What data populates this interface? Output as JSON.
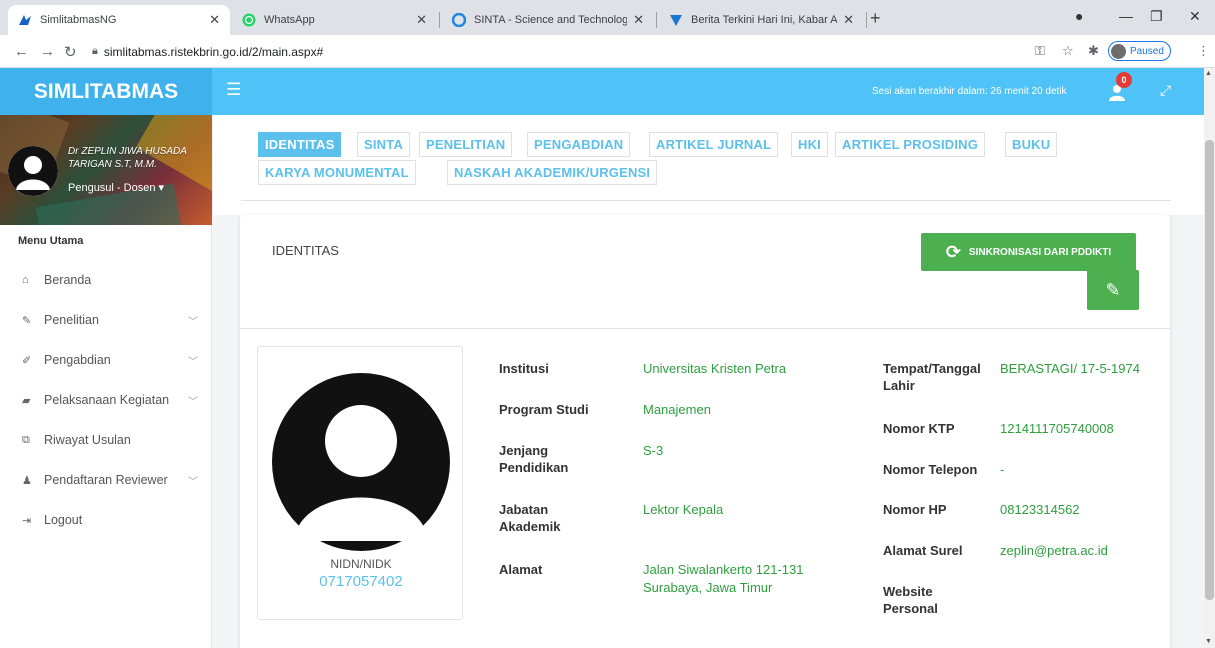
{
  "browser": {
    "tabs": [
      {
        "title": "SimlitabmasNG",
        "favicon": "simlitabmas-logo-icon"
      },
      {
        "title": "WhatsApp",
        "favicon": "whatsapp-icon"
      },
      {
        "title": "SINTA - Science and Technology I",
        "favicon": "sinta-icon"
      },
      {
        "title": "Berita Terkini Hari Ini, Kabar Akur",
        "favicon": "news-icon"
      }
    ],
    "url": "simlitabmas.ristekbrin.go.id/2/main.aspx#",
    "profile_status": "Paused"
  },
  "header": {
    "app_name": "SIMLITABMAS",
    "session_text": "Sesi akan berakhir dalam: 26 menit 20 detik",
    "notification_count": "0",
    "accent_color": "#4fc3f7"
  },
  "sidebar": {
    "user_name": "Dr ZEPLIN JIWA HUSADA TARIGAN S.T, M.M.",
    "user_role": "Pengusul - Dosen",
    "menu_heading": "Menu Utama",
    "items": [
      {
        "label": "Beranda",
        "icon": "home-icon",
        "has_children": false
      },
      {
        "label": "Penelitian",
        "icon": "edit-icon",
        "has_children": true
      },
      {
        "label": "Pengabdian",
        "icon": "pencil-icon",
        "has_children": true
      },
      {
        "label": "Pelaksanaan Kegiatan",
        "icon": "book-icon",
        "has_children": true
      },
      {
        "label": "Riwayat Usulan",
        "icon": "copy-icon",
        "has_children": false
      },
      {
        "label": "Pendaftaran Reviewer",
        "icon": "user-icon",
        "has_children": true
      },
      {
        "label": "Logout",
        "icon": "sign-out-icon",
        "has_children": false
      }
    ]
  },
  "profile_tabs": [
    {
      "label": "IDENTITAS",
      "active": true
    },
    {
      "label": "SINTA",
      "active": false
    },
    {
      "label": "PENELITIAN",
      "active": false
    },
    {
      "label": "PENGABDIAN",
      "active": false
    },
    {
      "label": "ARTIKEL JURNAL",
      "active": false
    },
    {
      "label": "HKI",
      "active": false
    },
    {
      "label": "ARTIKEL PROSIDING",
      "active": false
    },
    {
      "label": "BUKU",
      "active": false
    },
    {
      "label": "KARYA MONUMENTAL",
      "active": false
    },
    {
      "label": "NASKAH AKADEMIK/URGENSI",
      "active": false
    }
  ],
  "identity": {
    "title": "IDENTITAS",
    "sync_button": "SINKRONISASI DARI PDDIKTI",
    "nidn_label": "NIDN/NIDK",
    "nidn_value": "0717057402",
    "left_fields": [
      {
        "label": "Institusi",
        "value": "Universitas Kristen Petra"
      },
      {
        "label": "Program Studi",
        "value": "Manajemen"
      },
      {
        "label": "Jenjang Pendidikan",
        "value": "S-3"
      },
      {
        "label": "Jabatan Akademik",
        "value": "Lektor Kepala"
      },
      {
        "label": "Alamat",
        "value": "Jalan Siwalankerto 121-131 Surabaya, Jawa Timur"
      }
    ],
    "right_fields": [
      {
        "label": "Tempat/Tanggal Lahir",
        "value": "BERASTAGI/ 17-5-1974"
      },
      {
        "label": "Nomor KTP",
        "value": "1214111705740008"
      },
      {
        "label": "Nomor Telepon",
        "value": "-"
      },
      {
        "label": "Nomor HP",
        "value": "08123314562"
      },
      {
        "label": "Alamat Surel",
        "value": "zeplin@petra.ac.id"
      },
      {
        "label": "Website Personal",
        "value": ""
      }
    ],
    "value_color": "#2e9e3e"
  }
}
